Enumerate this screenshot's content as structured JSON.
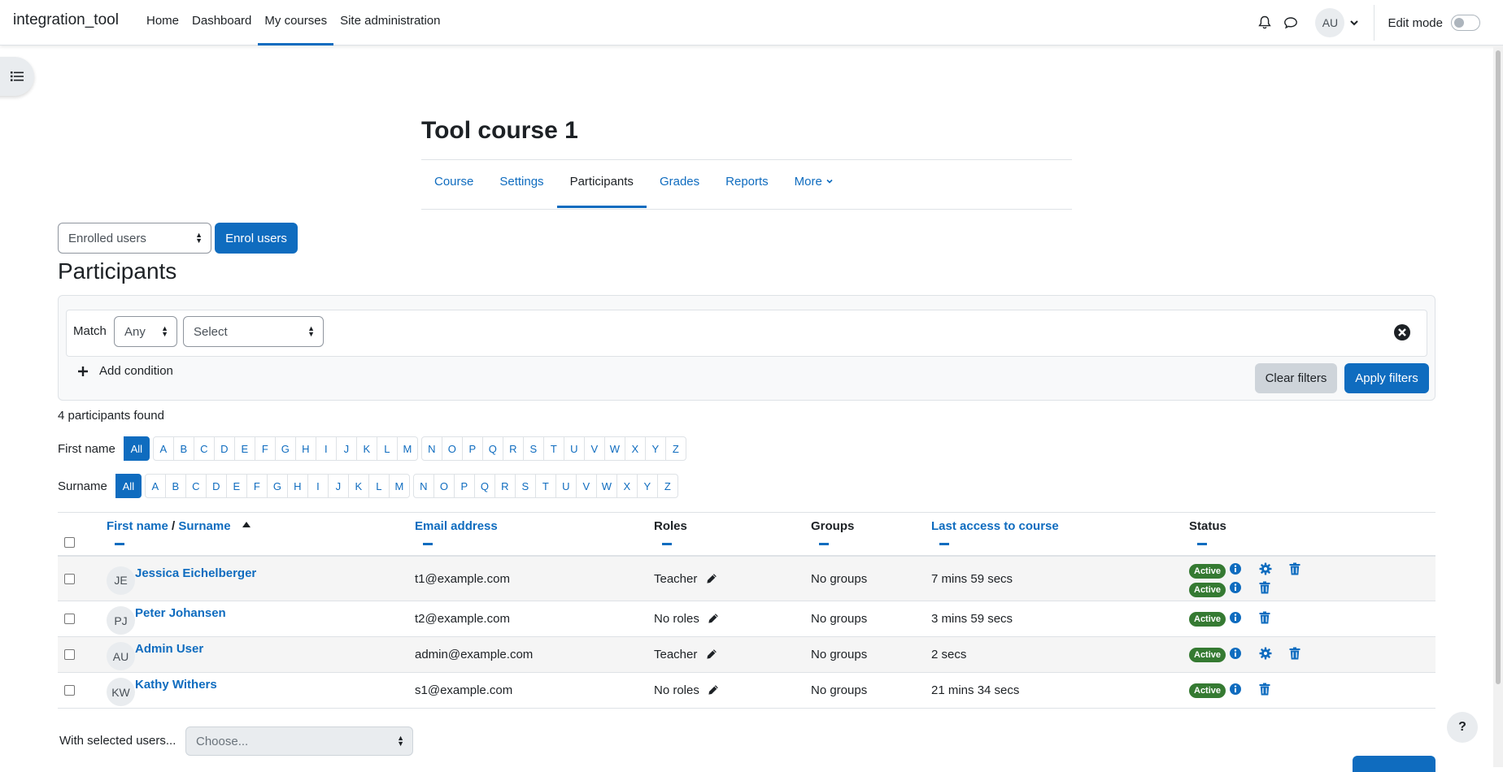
{
  "brand": "integration_tool",
  "primary_nav": [
    "Home",
    "Dashboard",
    "My courses",
    "Site administration"
  ],
  "user": {
    "initials": "AU"
  },
  "edit_mode_label": "Edit mode",
  "course": {
    "title": "Tool course 1",
    "tabs": [
      "Course",
      "Settings",
      "Participants",
      "Grades",
      "Reports"
    ],
    "more_label": "More"
  },
  "enrol": {
    "select_value": "Enrolled users",
    "button": "Enrol users"
  },
  "page_heading": "Participants",
  "filter": {
    "match_label": "Match",
    "match_value": "Any",
    "type_value": "Select",
    "add_condition": "Add condition",
    "clear": "Clear filters",
    "apply": "Apply filters"
  },
  "found_text": "4 participants found",
  "initials": {
    "firstname_label": "First name",
    "surname_label": "Surname",
    "all": "All",
    "letters_a_m": [
      "A",
      "B",
      "C",
      "D",
      "E",
      "F",
      "G",
      "H",
      "I",
      "J",
      "K",
      "L",
      "M"
    ],
    "letters_n_z": [
      "N",
      "O",
      "P",
      "Q",
      "R",
      "S",
      "T",
      "U",
      "V",
      "W",
      "X",
      "Y",
      "Z"
    ]
  },
  "table": {
    "headers": {
      "firstname": "First name",
      "slash": " / ",
      "surname": "Surname",
      "email": "Email address",
      "roles": "Roles",
      "groups": "Groups",
      "lastaccess": "Last access to course",
      "status": "Status"
    },
    "rows": [
      {
        "initials": "JE",
        "name": "Jessica Eichelberger",
        "email": "t1@example.com",
        "role": "Teacher",
        "groups": "No groups",
        "lastaccess": "7 mins 59 secs",
        "status": [
          "Active",
          "Active"
        ]
      },
      {
        "initials": "PJ",
        "name": "Peter Johansen",
        "email": "t2@example.com",
        "role": "No roles",
        "groups": "No groups",
        "lastaccess": "3 mins 59 secs",
        "status": [
          "Active"
        ]
      },
      {
        "initials": "AU",
        "name": "Admin User",
        "email": "admin@example.com",
        "role": "Teacher",
        "groups": "No groups",
        "lastaccess": "2 secs",
        "status": [
          "Active"
        ]
      },
      {
        "initials": "KW",
        "name": "Kathy Withers",
        "email": "s1@example.com",
        "role": "No roles",
        "groups": "No groups",
        "lastaccess": "21 mins 34 secs",
        "status": [
          "Active"
        ]
      }
    ]
  },
  "bulk": {
    "label": "With selected users...",
    "placeholder": "Choose..."
  },
  "help_label": "?",
  "colors": {
    "primary": "#0f6cbf",
    "success": "#357a32",
    "text": "#1d2125"
  }
}
